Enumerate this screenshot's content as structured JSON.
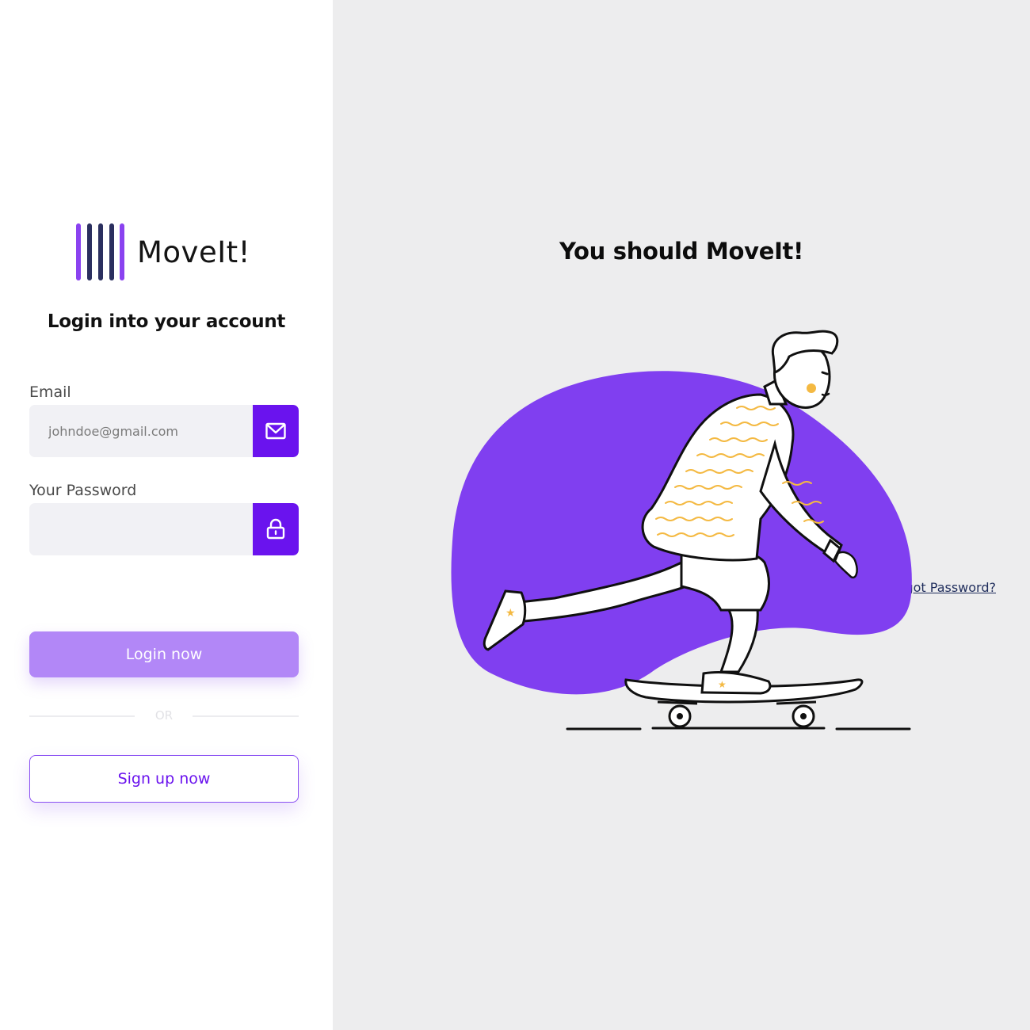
{
  "brand": {
    "name": "MoveIt!",
    "bar_colors": [
      "#8a42f0",
      "#2b2f5f",
      "#2b2f5f",
      "#2b2f5f",
      "#8a42f0"
    ]
  },
  "login": {
    "heading": "Login into your account",
    "email": {
      "label": "Email",
      "placeholder": "johndoe@gmail.com",
      "icon": "mail-icon"
    },
    "password": {
      "label": "Your Password",
      "placeholder": "",
      "icon": "lock-icon"
    },
    "forgot_label": "Forgot Password?",
    "login_label": "Login now",
    "divider_label": "OR",
    "signup_label": "Sign up now"
  },
  "hero": {
    "heading": "You should MoveIt!",
    "illustration": "skateboarder-illustration"
  },
  "colors": {
    "accent": "#6a13ee",
    "login_button": "#b287f7",
    "blob": "#803ff0",
    "sweater_stripes": "#f4b942",
    "panel_bg": "#ededee"
  }
}
